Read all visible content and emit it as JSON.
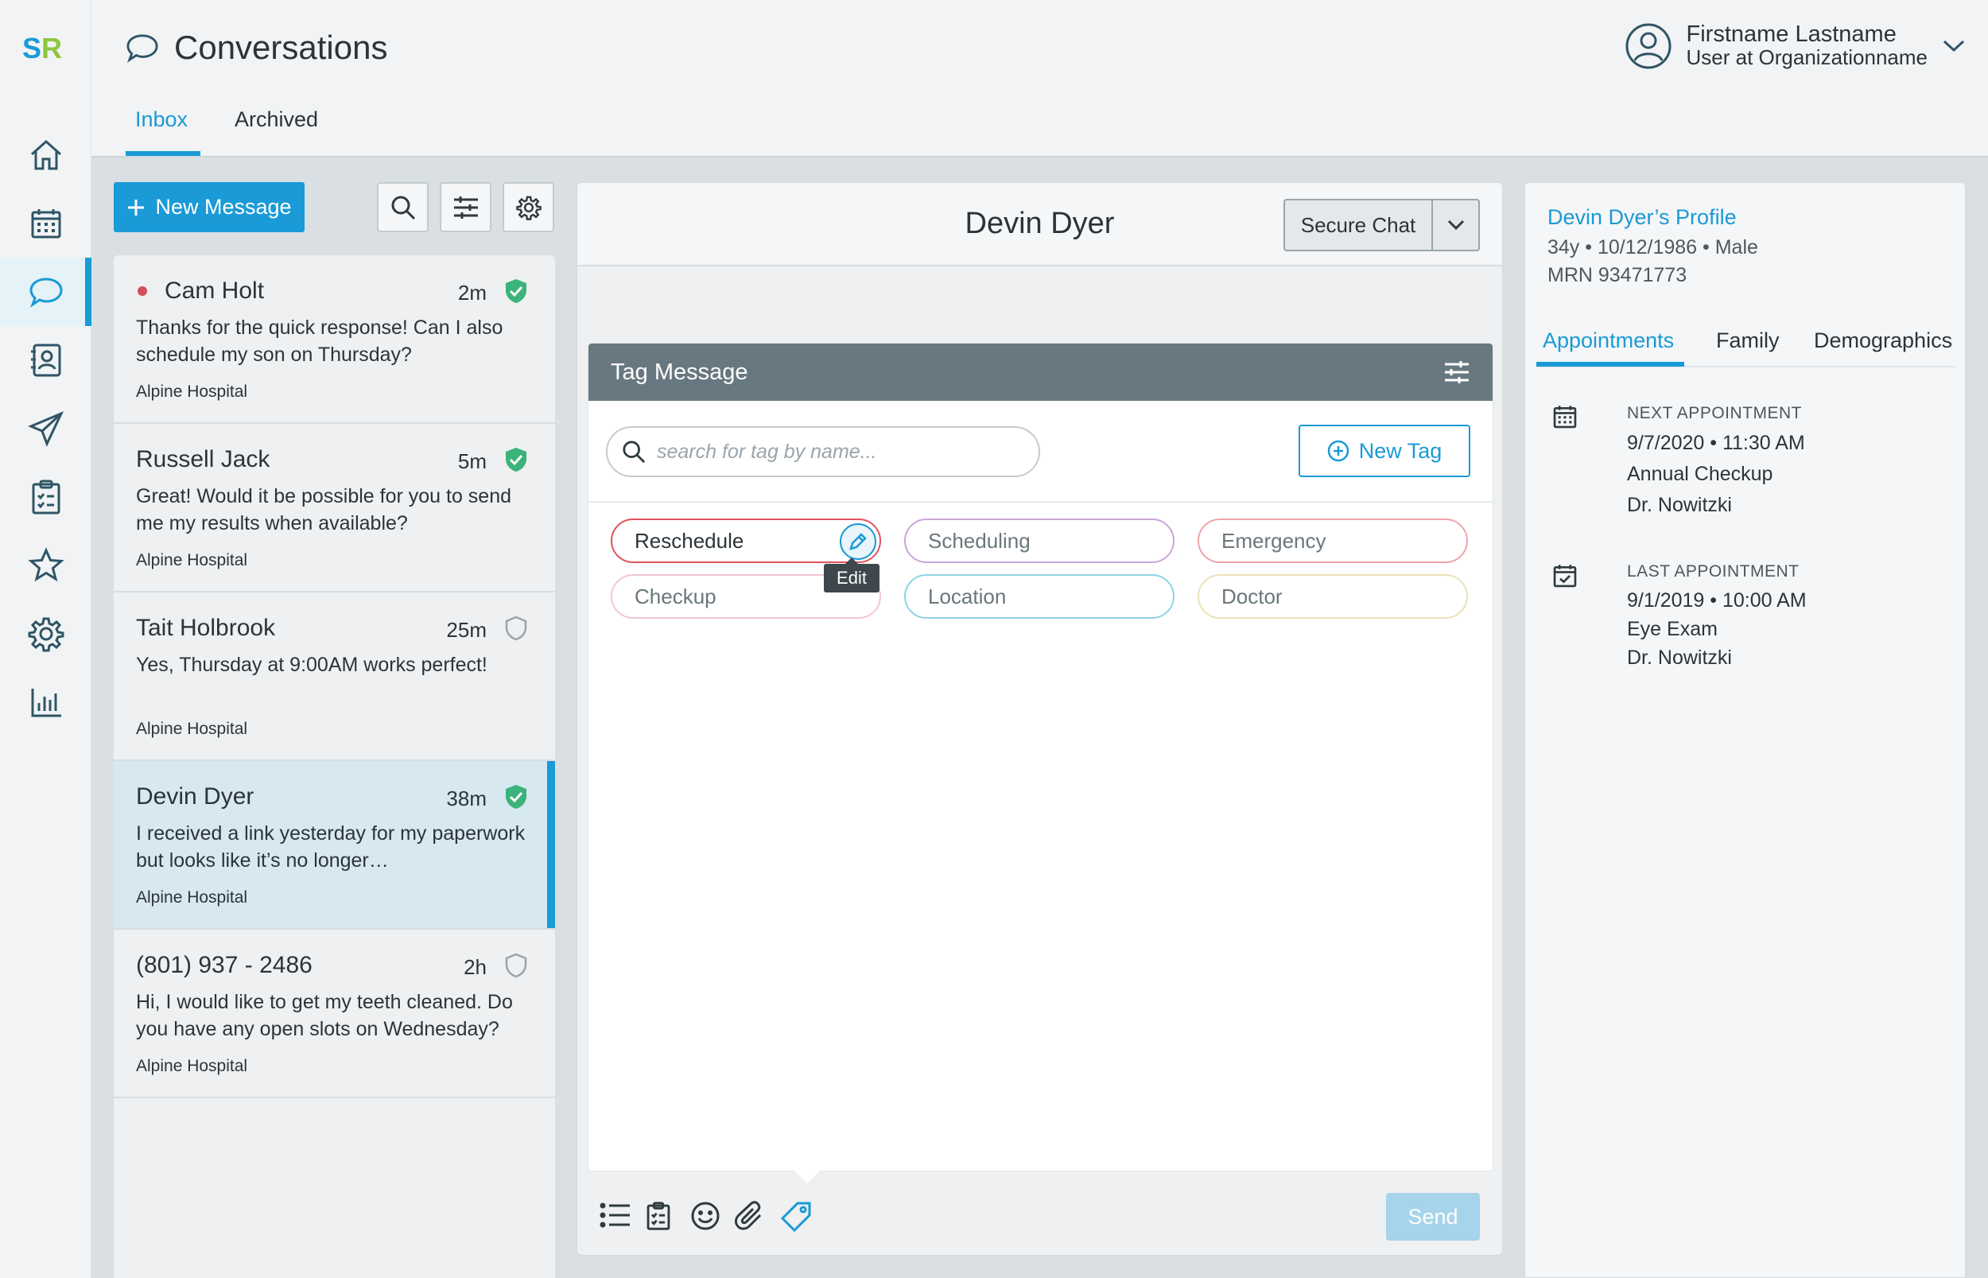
{
  "brand": {
    "logo_text": "SR",
    "primary": "#1a9ad6",
    "secondary": "#8dc63f",
    "unread": "#d74d5a",
    "verified": "#3bb37a"
  },
  "nav": {
    "items": [
      {
        "icon": "home-icon"
      },
      {
        "icon": "calendar-icon"
      },
      {
        "icon": "chat-icon",
        "active": true
      },
      {
        "icon": "contacts-icon"
      },
      {
        "icon": "send-icon"
      },
      {
        "icon": "clipboard-icon"
      },
      {
        "icon": "star-icon"
      },
      {
        "icon": "gear-icon"
      },
      {
        "icon": "bar-chart-icon"
      }
    ]
  },
  "header": {
    "title": "Conversations",
    "tabs": [
      {
        "label": "Inbox",
        "active": true
      },
      {
        "label": "Archived"
      }
    ],
    "user": {
      "name": "Firstname Lastname",
      "org": "User at Organizationname"
    }
  },
  "list": {
    "new_message_label": "New Message",
    "conversations": [
      {
        "name": "Cam Holt",
        "time": "2m",
        "verified": true,
        "unread": true,
        "message": "Thanks for the quick response! Can I also schedule my son on Thursday?",
        "org": "Alpine Hospital"
      },
      {
        "name": "Russell Jack",
        "time": "5m",
        "verified": true,
        "message": "Great! Would it be possible for you to send me my results when available?",
        "org": "Alpine Hospital"
      },
      {
        "name": "Tait Holbrook",
        "time": "25m",
        "verified": false,
        "message": "Yes, Thursday at 9:00AM works perfect!",
        "org": "Alpine Hospital"
      },
      {
        "name": "Devin Dyer",
        "time": "38m",
        "verified": true,
        "selected": true,
        "message": "I received a link yesterday for my paperwork but looks like it’s no longer…",
        "org": "Alpine Hospital"
      },
      {
        "name": "(801) 937 - 2486",
        "time": "2h",
        "verified": false,
        "message": "Hi, I would like to get my teeth cleaned. Do you have any open slots on Wednesday?",
        "org": "Alpine Hospital"
      }
    ]
  },
  "chat": {
    "contact_name": "Devin Dyer",
    "channel": "Secure Chat",
    "send_label": "Send",
    "tag_panel": {
      "title": "Tag Message",
      "search_placeholder": "search for tag by name...",
      "new_tag_label": "New Tag",
      "edit_tooltip": "Edit",
      "tags": [
        {
          "label": "Reschedule",
          "color": "#e0515c",
          "active": true
        },
        {
          "label": "Scheduling",
          "color": "#c9a6d8"
        },
        {
          "label": "Emergency",
          "color": "#f0a3aa"
        },
        {
          "label": "Checkup",
          "color": "#f3c6d3"
        },
        {
          "label": "Location",
          "color": "#8fd3e6"
        },
        {
          "label": "Doctor",
          "color": "#ebe2b8"
        }
      ]
    }
  },
  "profile": {
    "title": "Devin Dyer’s Profile",
    "demographics": "34y • 10/12/1986 • Male",
    "mrn": "MRN 93471773",
    "tabs": [
      {
        "label": "Appointments",
        "active": true
      },
      {
        "label": "Family"
      },
      {
        "label": "Demographics"
      }
    ],
    "next": {
      "label": "NEXT APPOINTMENT",
      "datetime": "9/7/2020 • 11:30 AM",
      "type": "Annual Checkup",
      "doctor": "Dr. Nowitzki"
    },
    "last": {
      "label": "LAST APPOINTMENT",
      "datetime": "9/1/2019 • 10:00 AM",
      "type": "Eye Exam",
      "doctor": "Dr. Nowitzki"
    }
  }
}
